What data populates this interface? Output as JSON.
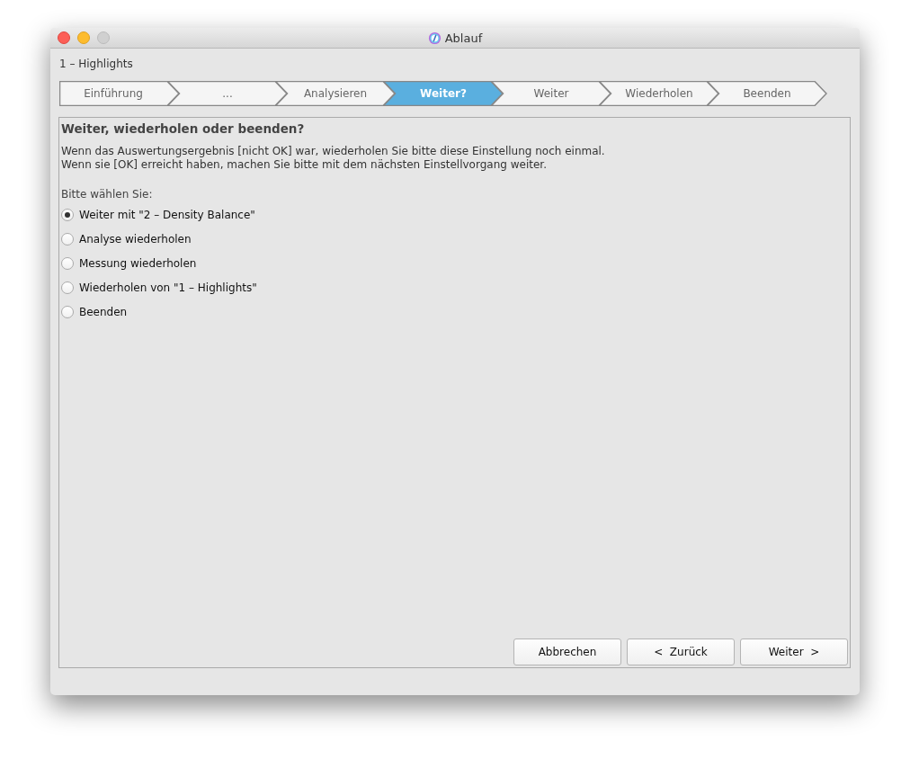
{
  "window": {
    "title": "Ablauf"
  },
  "header": "1 – Highlights",
  "steps": [
    {
      "label": "Einführung",
      "selected": false
    },
    {
      "label": "...",
      "selected": false
    },
    {
      "label": "Analysieren",
      "selected": false
    },
    {
      "label": "Weiter?",
      "selected": true
    },
    {
      "label": "Weiter",
      "selected": false
    },
    {
      "label": "Wiederholen",
      "selected": false
    },
    {
      "label": "Beenden",
      "selected": false
    }
  ],
  "panel": {
    "heading": "Weiter, wiederholen oder beenden?",
    "description": [
      "Wenn das Auswertungsergebnis [nicht OK] war, wiederholen Sie bitte diese Einstellung noch einmal.",
      "Wenn sie [OK] erreicht haben, machen Sie bitte mit dem nächsten Einstellvorgang weiter."
    ],
    "prompt": "Bitte wählen Sie:",
    "options": [
      {
        "label": "Weiter mit \"2 – Density Balance\"",
        "selected": true
      },
      {
        "label": "Analyse wiederholen",
        "selected": false
      },
      {
        "label": "Messung wiederholen",
        "selected": false
      },
      {
        "label": "Wiederholen von \"1 – Highlights\"",
        "selected": false
      },
      {
        "label": "Beenden",
        "selected": false
      }
    ]
  },
  "buttons": [
    "Abbrechen",
    "<  Zurück",
    "Weiter  >"
  ]
}
